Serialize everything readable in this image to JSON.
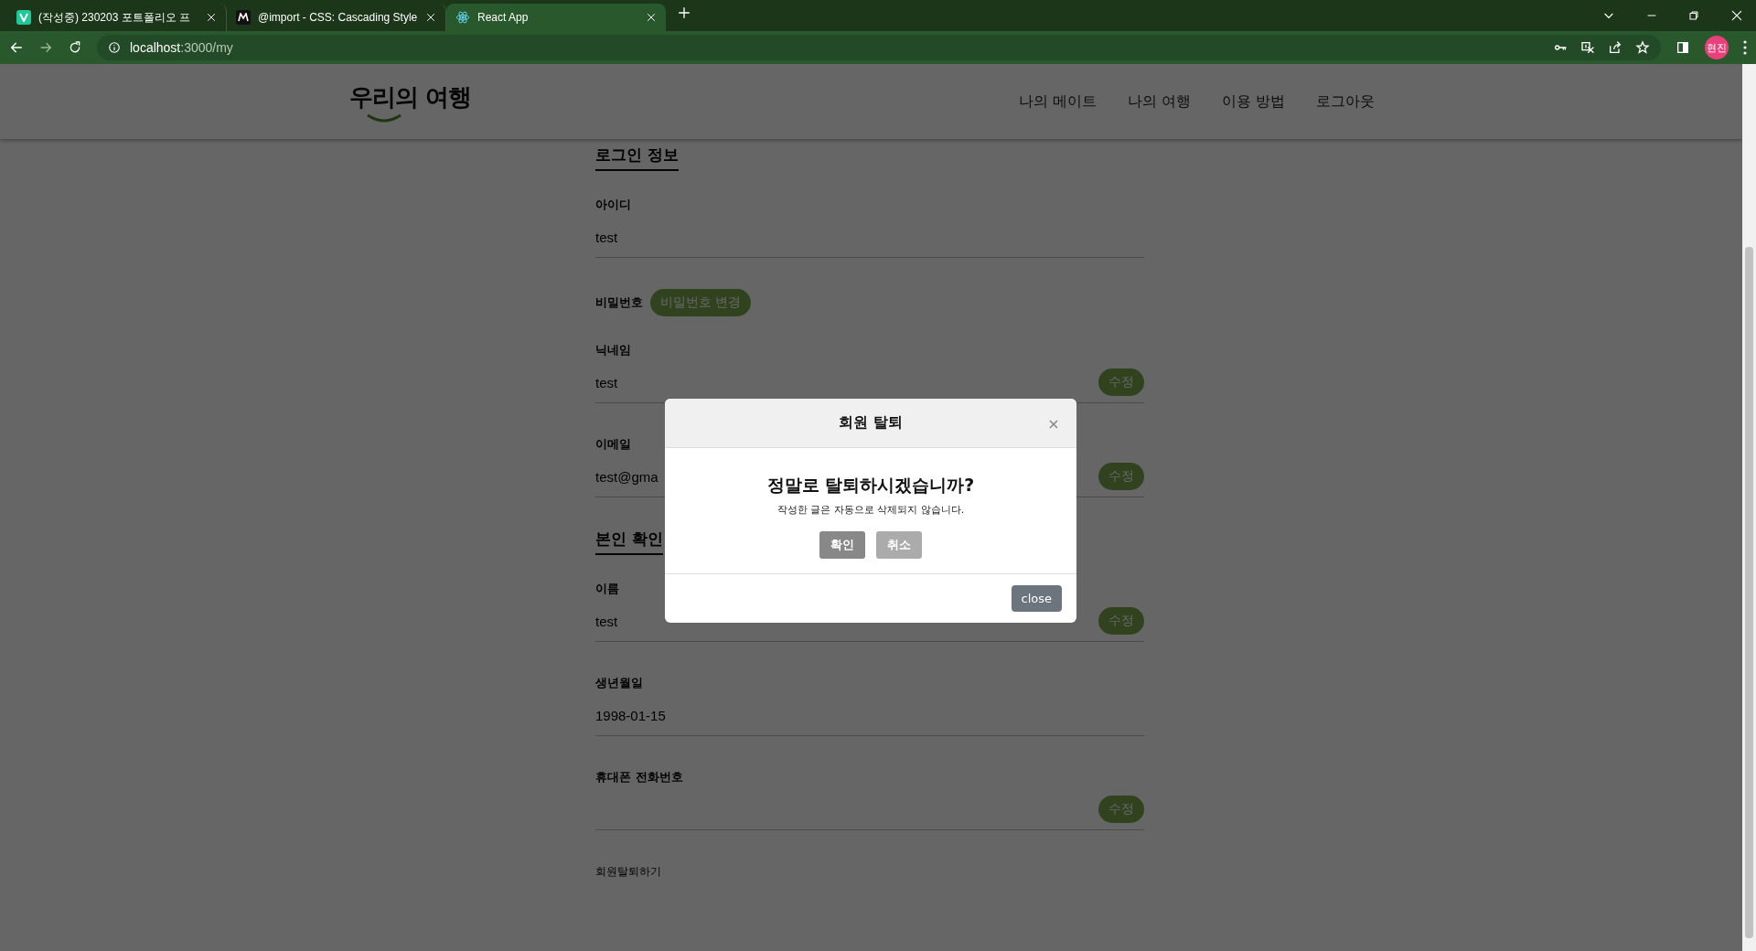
{
  "browser": {
    "tabs": [
      {
        "title": "(작성중) 230203 포트폴리오 프",
        "kind": "v",
        "selected": false
      },
      {
        "title": "@import - CSS: Cascading Style",
        "kind": "m",
        "selected": false
      },
      {
        "title": "React App",
        "kind": "react",
        "selected": true
      }
    ],
    "url_host": "localhost",
    "url_path": ":3000/my",
    "profile": "현진"
  },
  "header": {
    "logo": "우리의 여행",
    "nav": [
      "나의 메이트",
      "나의 여행",
      "이용 방법",
      "로그아웃"
    ]
  },
  "sections": [
    {
      "title": "로그인 정보",
      "fields": [
        {
          "label": "아이디",
          "value": "test",
          "kind": "text"
        },
        {
          "label": "비밀번호",
          "kind": "inline-button",
          "button": "비밀번호 변경"
        },
        {
          "label": "닉네임",
          "value": "test",
          "kind": "text",
          "button": "수정"
        },
        {
          "label": "이메일",
          "value": "test@gma",
          "kind": "text",
          "button": "수정"
        }
      ]
    },
    {
      "title": "본인 확인",
      "fields": [
        {
          "label": "이름",
          "value": "test",
          "kind": "text",
          "button": "수정"
        },
        {
          "label": "생년월일",
          "value": "1998-01-15",
          "kind": "text"
        },
        {
          "label": "휴대폰 전화번호",
          "kind": "text",
          "button": "수정"
        }
      ]
    }
  ],
  "withdraw_link": "회원탈퇴하기",
  "modal": {
    "title": "회원 탈퇴",
    "question": "정말로 탈퇴하시겠습니까?",
    "note": "작성한 글은 자동으로 삭제되지 않습니다.",
    "buttons": [
      {
        "label": "확인",
        "kind": "primary"
      },
      {
        "label": "취소",
        "kind": "secondary"
      }
    ],
    "footer_button": "close"
  }
}
